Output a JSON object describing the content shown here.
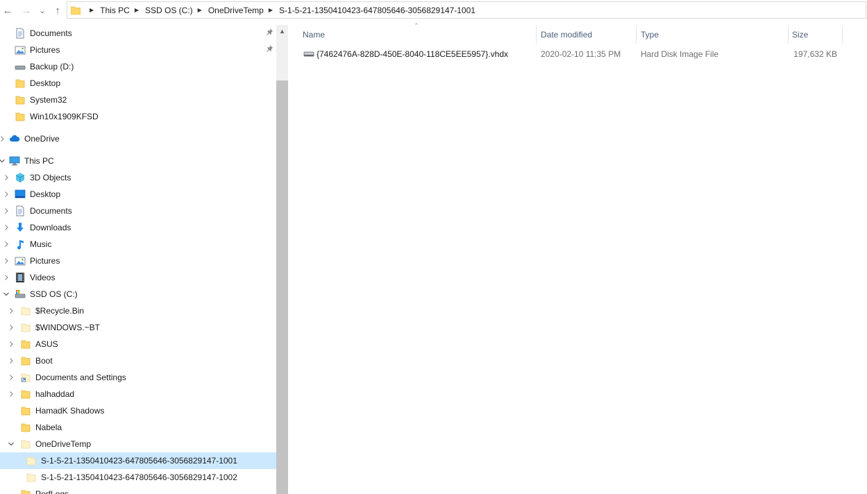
{
  "nav_buttons": {
    "back": "←",
    "forward": "→",
    "recent": "⌄",
    "up": "↑"
  },
  "address": {
    "crumbs": [
      "This PC",
      "SSD OS (C:)",
      "OneDriveTemp",
      "S-1-5-21-1350410423-647805646-3056829147-1001"
    ]
  },
  "nav_tree": [
    {
      "label": "Documents",
      "indent": 1,
      "icon": "document-icon",
      "pinned": true
    },
    {
      "label": "Pictures",
      "indent": 1,
      "icon": "pictures-icon",
      "pinned": true
    },
    {
      "label": "Backup (D:)",
      "indent": 1,
      "icon": "drive-icon"
    },
    {
      "label": "Desktop",
      "indent": 1,
      "icon": "folder-icon"
    },
    {
      "label": "System32",
      "indent": 1,
      "icon": "folder-icon"
    },
    {
      "label": "Win10x1909KFSD",
      "indent": 1,
      "icon": "folder-icon"
    },
    {
      "label": "OneDrive",
      "indent": 0,
      "icon": "cloud-icon",
      "chevron": "right",
      "gap": true
    },
    {
      "label": "This PC",
      "indent": 0,
      "icon": "computer-icon",
      "chevron": "down",
      "gap": true
    },
    {
      "label": "3D Objects",
      "indent": 1,
      "icon": "cube-icon",
      "chevron": "right"
    },
    {
      "label": "Desktop",
      "indent": 1,
      "icon": "desktop-icon",
      "chevron": "right"
    },
    {
      "label": "Documents",
      "indent": 1,
      "icon": "document-icon",
      "chevron": "right"
    },
    {
      "label": "Downloads",
      "indent": 1,
      "icon": "download-icon",
      "chevron": "right"
    },
    {
      "label": "Music",
      "indent": 1,
      "icon": "music-icon",
      "chevron": "right"
    },
    {
      "label": "Pictures",
      "indent": 1,
      "icon": "pictures-icon",
      "chevron": "right"
    },
    {
      "label": "Videos",
      "indent": 1,
      "icon": "video-icon",
      "chevron": "right"
    },
    {
      "label": "SSD OS (C:)",
      "indent": 1,
      "icon": "os-drive-icon",
      "chevron": "down"
    },
    {
      "label": "$Recycle.Bin",
      "indent": 2,
      "icon": "folder-pale-icon",
      "chevron": "right"
    },
    {
      "label": "$WINDOWS.~BT",
      "indent": 2,
      "icon": "folder-pale-icon",
      "chevron": "right"
    },
    {
      "label": "ASUS",
      "indent": 2,
      "icon": "folder-icon",
      "chevron": "right"
    },
    {
      "label": "Boot",
      "indent": 2,
      "icon": "folder-icon",
      "chevron": "right"
    },
    {
      "label": "Documents and Settings",
      "indent": 2,
      "icon": "shortcut-folder-icon",
      "chevron": "right"
    },
    {
      "label": "halhaddad",
      "indent": 2,
      "icon": "folder-icon",
      "chevron": "right"
    },
    {
      "label": "HamadK Shadows",
      "indent": 2,
      "icon": "folder-icon"
    },
    {
      "label": "Nabela",
      "indent": 2,
      "icon": "folder-icon"
    },
    {
      "label": "OneDriveTemp",
      "indent": 2,
      "icon": "folder-pale-icon",
      "chevron": "down"
    },
    {
      "label": "S-1-5-21-1350410423-647805646-3056829147-1001",
      "indent": 3,
      "icon": "folder-pale-icon",
      "selected": true
    },
    {
      "label": "S-1-5-21-1350410423-647805646-3056829147-1002",
      "indent": 3,
      "icon": "folder-pale-icon"
    },
    {
      "label": "PerfLogs",
      "indent": 2,
      "icon": "folder-icon"
    }
  ],
  "columns": {
    "name": "Name",
    "date": "Date modified",
    "type": "Type",
    "size": "Size"
  },
  "files": [
    {
      "name": "{7462476A-828D-450E-8040-118CE5EE5957}.vhdx",
      "date": "2020-02-10 11:35 PM",
      "type": "Hard Disk Image File",
      "size": "197,632 KB",
      "icon": "disk-image-icon"
    }
  ],
  "colors": {
    "selected_row": "#cce8ff",
    "header_text": "#4c607a",
    "folder": "#ffd76a"
  }
}
